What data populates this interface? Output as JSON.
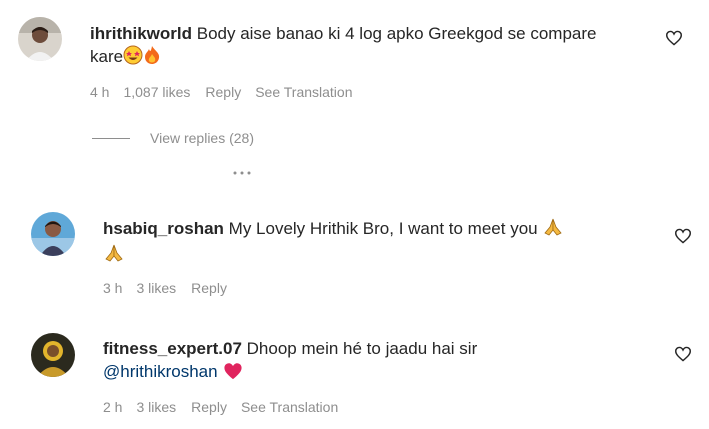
{
  "comments": [
    {
      "username": "ihrithikworld",
      "text": "Body aise banao ki 4 log apko Greekgod se compare kare",
      "time": "4 h",
      "likes": "1,087 likes",
      "reply_label": "Reply",
      "translation_label": "See Translation",
      "emojis": [
        "star-struck-emoji",
        "fire-emoji"
      ]
    },
    {
      "username": "hsabiq_roshan",
      "text": "My Lovely Hrithik Bro, I want to meet you",
      "time": "3 h",
      "likes": "3 likes",
      "reply_label": "Reply",
      "emojis": [
        "folded-hands-emoji",
        "folded-hands-emoji"
      ]
    },
    {
      "username": "fitness_expert.07",
      "text": "Dhoop mein hé to jaadu hai sir",
      "mention": "@hrithikroshan",
      "time": "2 h",
      "likes": "3 likes",
      "reply_label": "Reply",
      "translation_label": "See Translation",
      "emojis": [
        "red-heart-emoji"
      ]
    }
  ],
  "view_replies": "View replies (28)",
  "colors": {
    "text": "#262626",
    "muted": "#8e8e8e",
    "mention": "#00376b",
    "heart_emoji": "#e0245e"
  }
}
